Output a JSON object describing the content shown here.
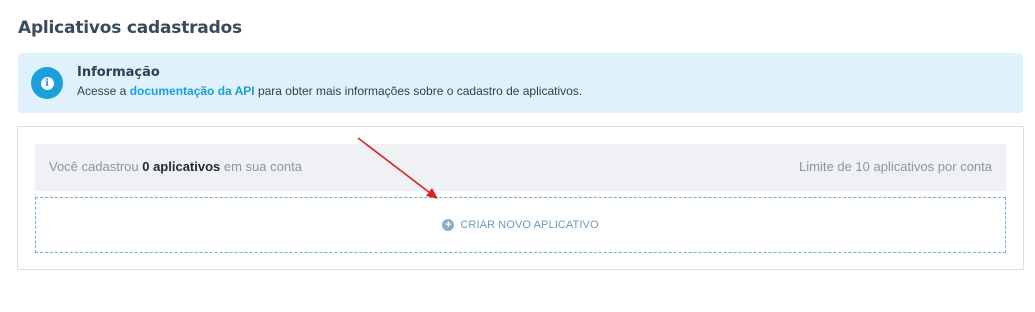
{
  "page": {
    "title": "Aplicativos cadastrados"
  },
  "info": {
    "icon": "info-icon",
    "title": "Informação",
    "text_before": "Acesse a ",
    "link_label": "documentação da API",
    "text_after": " para obter mais informações sobre o cadastro de aplicativos."
  },
  "summary": {
    "prefix": "Você cadastrou ",
    "count_label": "0 aplicativos",
    "suffix": " em sua conta",
    "limit_text": "Limite de 10 aplicativos por conta"
  },
  "create": {
    "icon": "plus-circle-icon",
    "label": "CRIAR NOVO APLICATIVO"
  },
  "colors": {
    "accent": "#1ba0db",
    "info_background": "#dff2fb",
    "arrow": "#e02020",
    "dashed_border": "#6eaed0"
  }
}
